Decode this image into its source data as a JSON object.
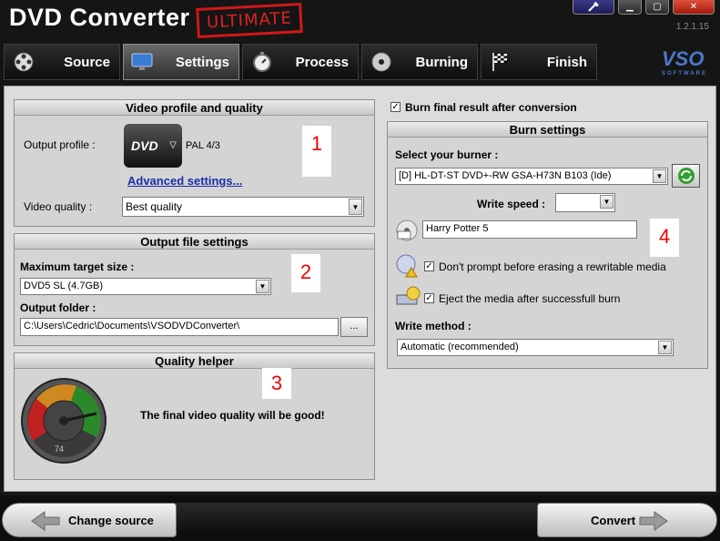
{
  "app": {
    "title": "DVD Converter",
    "edition": "ULTIMATE",
    "version": "1.2.1.15",
    "logo": "VSO",
    "logo_sub": "SOFTWARE"
  },
  "window_buttons": [
    {
      "name": "help",
      "icon": "hammer-icon"
    },
    {
      "name": "minimize",
      "icon": "minimize-icon"
    },
    {
      "name": "maximize",
      "icon": "maximize-icon"
    },
    {
      "name": "close",
      "icon": "close-icon"
    }
  ],
  "tabs": [
    {
      "label": "Source",
      "icon": "film-reel-icon"
    },
    {
      "label": "Settings",
      "icon": "monitor-icon"
    },
    {
      "label": "Process",
      "icon": "stopwatch-icon"
    },
    {
      "label": "Burning",
      "icon": "disc-icon"
    },
    {
      "label": "Finish",
      "icon": "checkered-flag-icon"
    }
  ],
  "video_profile": {
    "header": "Video profile and quality",
    "output_profile_label": "Output profile :",
    "profile_value": "PAL 4/3",
    "profile_logo": "DVD",
    "advanced_link": "Advanced settings...",
    "video_quality_label": "Video quality :",
    "video_quality_value": "Best quality",
    "marker": "1"
  },
  "output_file": {
    "header": "Output file settings",
    "max_size_label": "Maximum target size :",
    "max_size_value": "DVD5 SL (4.7GB)",
    "folder_label": "Output folder :",
    "folder_value": "C:\\Users\\Cedric\\Documents\\VSODVDConverter\\",
    "browse_label": "...",
    "marker": "2"
  },
  "quality_helper": {
    "header": "Quality helper",
    "message": "The final video quality will be good!",
    "gauge_value": "74",
    "marker": "3"
  },
  "burn": {
    "burn_final_label": "Burn final result after conversion",
    "burn_final_checked": true,
    "header": "Burn settings",
    "select_burner_label": "Select your burner :",
    "burner_value": "[D] HL-DT-ST DVD+-RW GSA-H73N B103 (Ide)",
    "write_speed_label": "Write speed :",
    "write_speed_value": "",
    "disc_label_value": "Harry Potter 5",
    "dont_prompt_label": "Don't prompt before erasing a rewritable media",
    "eject_label": "Eject the media after successfull burn",
    "write_method_label": "Write method :",
    "write_method_value": "Automatic (recommended)",
    "marker": "4"
  },
  "bottom": {
    "change_source": "Change source",
    "convert": "Convert"
  }
}
